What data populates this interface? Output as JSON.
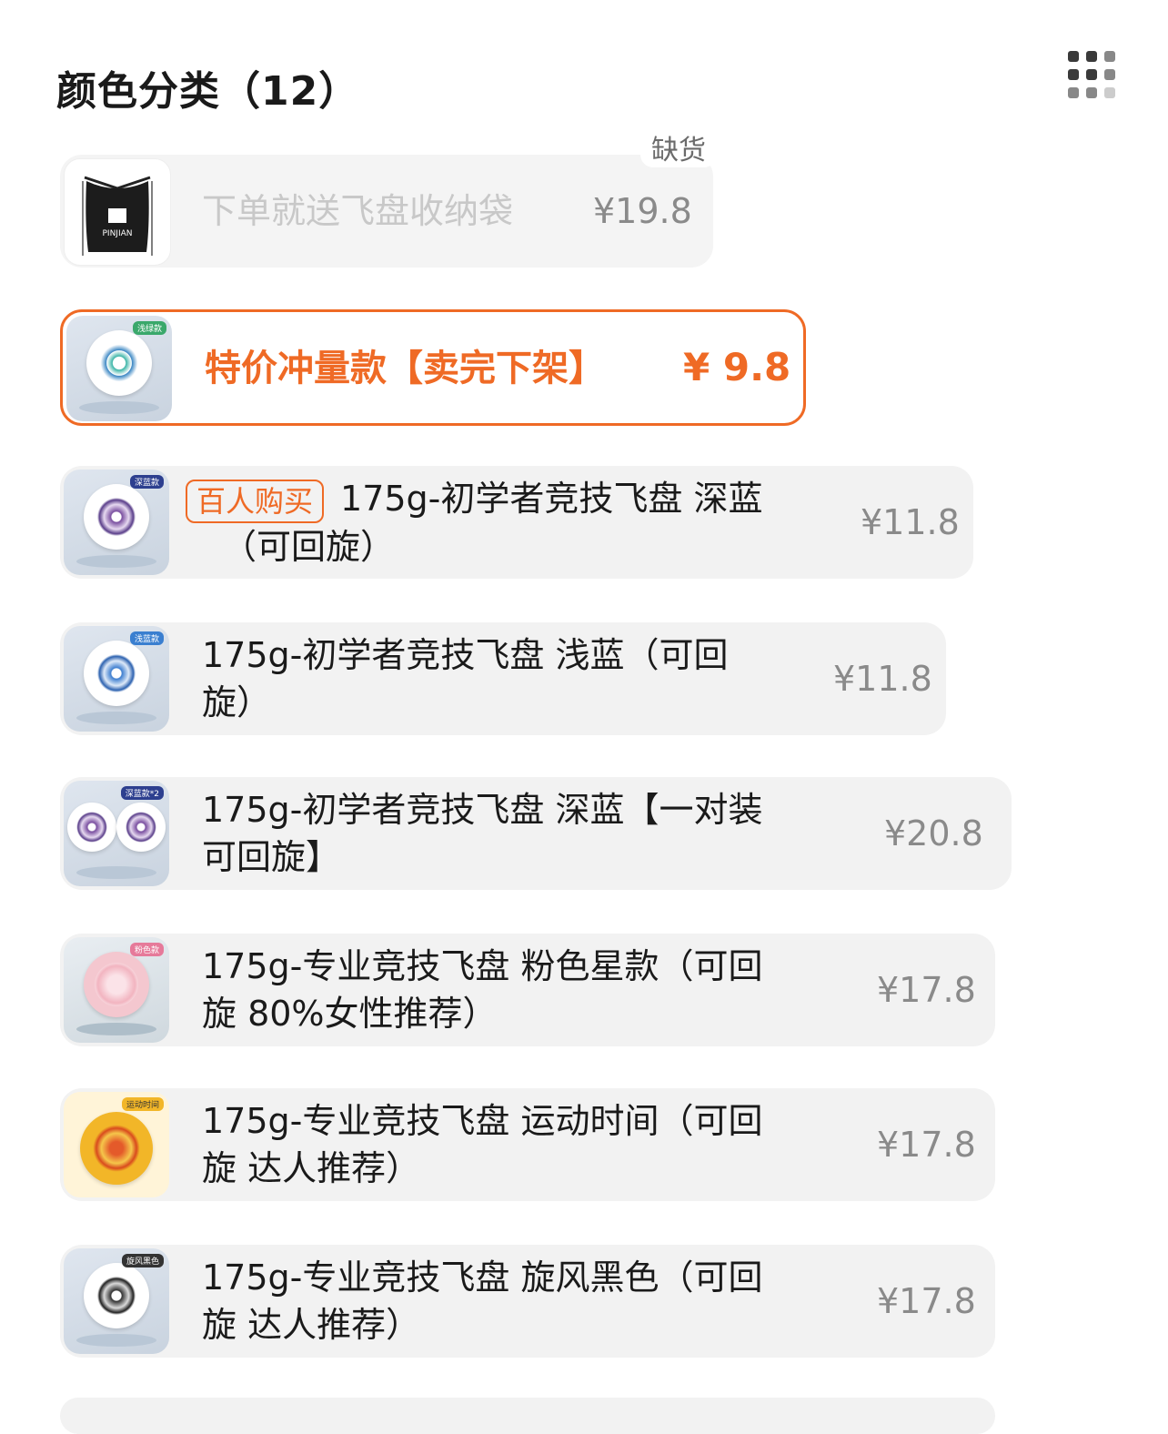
{
  "header": {
    "title": "颜色分类（12）",
    "grid_icon": "grid-view-icon"
  },
  "items": [
    {
      "name": "下单就送飞盘收纳袋",
      "price": "¥19.8",
      "status": "缺货"
    },
    {
      "name": "特价冲量款【卖完下架】",
      "price": "¥ 9.8",
      "tag": "浅绿款"
    },
    {
      "badge": "百人购买",
      "name_line1": "175g-初学者竞技飞盘 深蓝",
      "name_line2": "（可回旋）",
      "price": "¥11.8",
      "tag": "深蓝款"
    },
    {
      "name_line1": "175g-初学者竞技飞盘 浅蓝（可回",
      "name_line2": "旋）",
      "price": "¥11.8",
      "tag": "浅蓝款"
    },
    {
      "name_line1": "175g-初学者竞技飞盘 深蓝【一对装",
      "name_line2": "可回旋】",
      "price": "¥20.8",
      "tag": "深蓝款*2"
    },
    {
      "name_line1": "175g-专业竞技飞盘 粉色星款（可回",
      "name_line2": "旋 80%女性推荐）",
      "price": "¥17.8",
      "tag": "粉色款"
    },
    {
      "name_line1": "175g-专业竞技飞盘 运动时间（可回",
      "name_line2": "旋 达人推荐）",
      "price": "¥17.8",
      "tag": "运动时间"
    },
    {
      "name_line1": "175g-专业竞技飞盘 旋风黑色（可回",
      "name_line2": "旋 达人推荐）",
      "price": "¥17.8",
      "tag": "旋风黑色"
    }
  ],
  "colors": {
    "accent": "#ef6a25",
    "card_bg": "#f2f2f2",
    "muted_text": "#8a8a8a"
  }
}
